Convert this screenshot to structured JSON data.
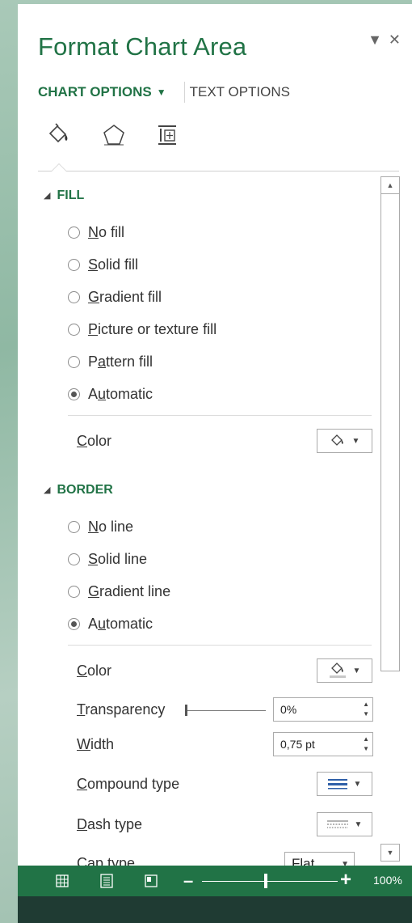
{
  "pane": {
    "title": "Format Chart Area",
    "tabs": {
      "chart_options": "CHART OPTIONS",
      "text_options": "TEXT OPTIONS"
    },
    "icons": [
      "fill-line-icon",
      "effects-pentagon-icon",
      "size-properties-icon"
    ]
  },
  "fill": {
    "header": "FILL",
    "options": [
      {
        "pre": "",
        "u": "N",
        "post": "o fill",
        "selected": false
      },
      {
        "pre": "",
        "u": "S",
        "post": "olid fill",
        "selected": false
      },
      {
        "pre": "",
        "u": "G",
        "post": "radient fill",
        "selected": false
      },
      {
        "pre": "",
        "u": "P",
        "post": "icture or texture fill",
        "selected": false
      },
      {
        "pre": "P",
        "u": "a",
        "post": "ttern fill",
        "selected": false
      },
      {
        "pre": "A",
        "u": "u",
        "post": "tomatic",
        "selected": true
      }
    ],
    "color_label": {
      "u": "C",
      "post": "olor"
    }
  },
  "border": {
    "header": "BORDER",
    "options": [
      {
        "pre": "",
        "u": "N",
        "post": "o line",
        "selected": false
      },
      {
        "pre": "",
        "u": "S",
        "post": "olid line",
        "selected": false
      },
      {
        "pre": "",
        "u": "G",
        "post": "radient line",
        "selected": false
      },
      {
        "pre": "A",
        "u": "u",
        "post": "tomatic",
        "selected": true
      }
    ],
    "color_label": {
      "u": "C",
      "post": "olor"
    },
    "transparency_label": {
      "u": "T",
      "post": "ransparency"
    },
    "transparency_value": "0%",
    "width_label": {
      "u": "W",
      "post": "idth"
    },
    "width_value": "0,75 pt",
    "compound_label": {
      "u": "C",
      "post": "ompound type"
    },
    "dash_label": {
      "u": "D",
      "post": "ash type"
    },
    "cap_label": "Cap type",
    "cap_value": "Flat"
  },
  "status": {
    "zoom": "100%",
    "slider_fraction": 0.47
  },
  "colors": {
    "accent": "#217346",
    "status_bar": "#217346"
  }
}
